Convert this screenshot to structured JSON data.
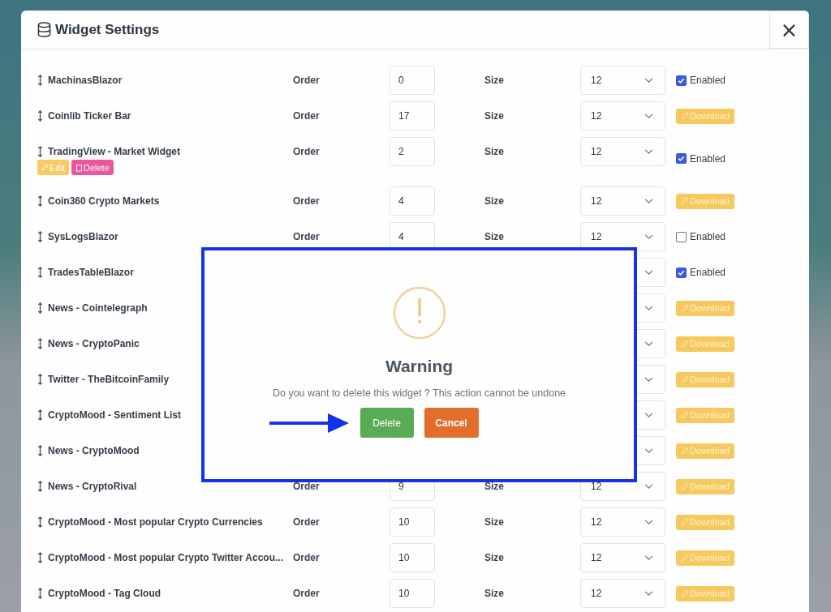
{
  "modal": {
    "title": "Widget Settings",
    "close": "×"
  },
  "rows": [
    {
      "name": "MachinasBlazor",
      "order_label": "Order",
      "order": "0",
      "size_label": "Size",
      "size": "12",
      "action": {
        "kind": "checkbox",
        "label": "Enabled",
        "checked": true
      }
    },
    {
      "name": "Coinlib Ticker Bar",
      "order_label": "Order",
      "order": "17",
      "size_label": "Size",
      "size": "12",
      "action": {
        "kind": "button",
        "label": "Download"
      }
    },
    {
      "name": "TradingView - Market Widget",
      "order_label": "Order",
      "order": "2",
      "size_label": "Size",
      "size": "12",
      "buttons": [
        {
          "kind": "edit",
          "label": "Edit"
        },
        {
          "kind": "delete",
          "label": "Delete"
        }
      ],
      "action": {
        "kind": "checkbox",
        "label": "Enabled",
        "checked": true
      }
    },
    {
      "name": "Coin360 Crypto Markets",
      "order_label": "Order",
      "order": "4",
      "size_label": "Size",
      "size": "12",
      "action": {
        "kind": "button",
        "label": "Download"
      }
    },
    {
      "name": "SysLogsBlazor",
      "order_label": "Order",
      "order": "4",
      "size_label": "Size",
      "size": "12",
      "action": {
        "kind": "checkbox",
        "label": "Enabled",
        "checked": false
      }
    },
    {
      "name": "TradesTableBlazor",
      "action": {
        "kind": "checkbox",
        "label": "Enabled",
        "checked": true
      }
    },
    {
      "name": "News - Cointelegraph",
      "action": {
        "kind": "button",
        "label": "Download"
      }
    },
    {
      "name": "News - CryptoPanic",
      "action": {
        "kind": "button",
        "label": "Download"
      }
    },
    {
      "name": "Twitter - TheBitcoinFamily",
      "action": {
        "kind": "button",
        "label": "Download"
      }
    },
    {
      "name": "CryptoMood - Sentiment List",
      "action": {
        "kind": "button",
        "label": "Download"
      }
    },
    {
      "name": "News - CryptoMood",
      "action": {
        "kind": "button",
        "label": "Download"
      }
    },
    {
      "name": "News - CryptoRival",
      "order_label": "Order",
      "order": "9",
      "size_label": "Size",
      "size": "12",
      "action": {
        "kind": "button",
        "label": "Download"
      }
    },
    {
      "name": "CryptoMood - Most popular Crypto Currencies",
      "order_label": "Order",
      "order": "10",
      "size_label": "Size",
      "size": "12",
      "action": {
        "kind": "button",
        "label": "Download"
      }
    },
    {
      "name": "CryptoMood - Most popular Crypto Twitter Accou...",
      "order_label": "Order",
      "order": "10",
      "size_label": "Size",
      "size": "12",
      "action": {
        "kind": "button",
        "label": "Download"
      }
    },
    {
      "name": "CryptoMood - Tag Cloud",
      "order_label": "Order",
      "order": "10",
      "size_label": "Size",
      "size": "12",
      "action": {
        "kind": "button",
        "label": "Download"
      }
    }
  ],
  "dialog": {
    "title": "Warning",
    "message": "Do you want to delete this widget ? This action cannot be undone",
    "buttons": [
      {
        "kind": "confirm",
        "label": "Delete"
      },
      {
        "kind": "cancel",
        "label": "Cancel"
      }
    ]
  }
}
